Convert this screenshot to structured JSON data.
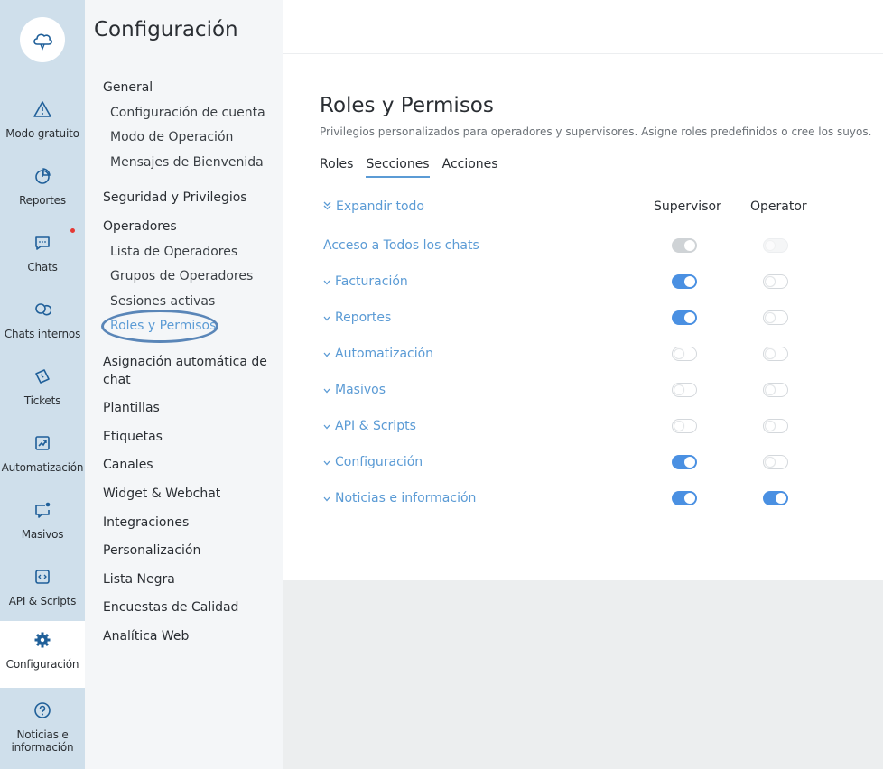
{
  "rail": {
    "items": [
      {
        "label": "Modo gratuito",
        "icon": "warning-icon"
      },
      {
        "label": "Reportes",
        "icon": "pie-chart-icon"
      },
      {
        "label": "Chats",
        "icon": "chat-icon"
      },
      {
        "label": "Chats internos",
        "icon": "internal-chats-icon"
      },
      {
        "label": "Tickets",
        "icon": "ticket-icon"
      },
      {
        "label": "Automatización",
        "icon": "automation-icon"
      },
      {
        "label": "Masivos",
        "icon": "broadcast-icon"
      },
      {
        "label": "API & Scripts",
        "icon": "code-icon"
      },
      {
        "label": "Configuración",
        "icon": "gear-icon"
      },
      {
        "label": "Noticias e información",
        "icon": "help-icon"
      }
    ],
    "accent": "#1f5f99"
  },
  "menu": {
    "title": "Configuración",
    "general": "General",
    "config_cuenta": "Configuración de cuenta",
    "modo_operacion": "Modo de Operación",
    "mensajes": "Mensajes de Bienvenida",
    "seguridad": "Seguridad y Privilegios",
    "operadores": "Operadores",
    "lista_operadores": "Lista de Operadores",
    "grupos_operadores": "Grupos de Operadores",
    "sesiones": "Sesiones activas",
    "roles": "Roles y Permisos",
    "asignacion": "Asignación automática de chat",
    "plantillas": "Plantillas",
    "etiquetas": "Etiquetas",
    "canales": "Canales",
    "widget": "Widget & Webchat",
    "integraciones": "Integraciones",
    "personalizacion": "Personalización",
    "lista_negra": "Lista Negra",
    "encuestas": "Encuestas de Calidad",
    "analitica": "Analítica Web"
  },
  "main": {
    "title": "Roles y Permisos",
    "subtitle": "Privilegios personalizados para operadores y supervisores. Asigne roles predefinidos o cree los suyos.",
    "tabs": [
      "Roles",
      "Secciones",
      "Acciones"
    ],
    "active_tab": "Secciones",
    "expand_all": "Expandir todo",
    "col_supervisor": "Supervisor",
    "col_operator": "Operator",
    "rows": [
      {
        "label": "Acceso a Todos los chats",
        "chevron": false,
        "supervisor": "disabled-on",
        "operator": "disabled-off"
      },
      {
        "label": "Facturación",
        "chevron": true,
        "supervisor": "on",
        "operator": "off"
      },
      {
        "label": "Reportes",
        "chevron": true,
        "supervisor": "on",
        "operator": "off"
      },
      {
        "label": "Automatización",
        "chevron": true,
        "supervisor": "off",
        "operator": "off"
      },
      {
        "label": "Masivos",
        "chevron": true,
        "supervisor": "off",
        "operator": "off"
      },
      {
        "label": "API & Scripts",
        "chevron": true,
        "supervisor": "off",
        "operator": "off"
      },
      {
        "label": "Configuración",
        "chevron": true,
        "supervisor": "on",
        "operator": "off"
      },
      {
        "label": "Noticias e información",
        "chevron": true,
        "supervisor": "on",
        "operator": "on"
      }
    ]
  },
  "colors": {
    "link": "#5b9bd5",
    "toggle_on": "#4a90e2",
    "rail_bg": "#cfdfeb",
    "menu_bg": "#f4f6f8",
    "highlight_ring": "#5a86b8",
    "notification_dot": "#e53935"
  }
}
